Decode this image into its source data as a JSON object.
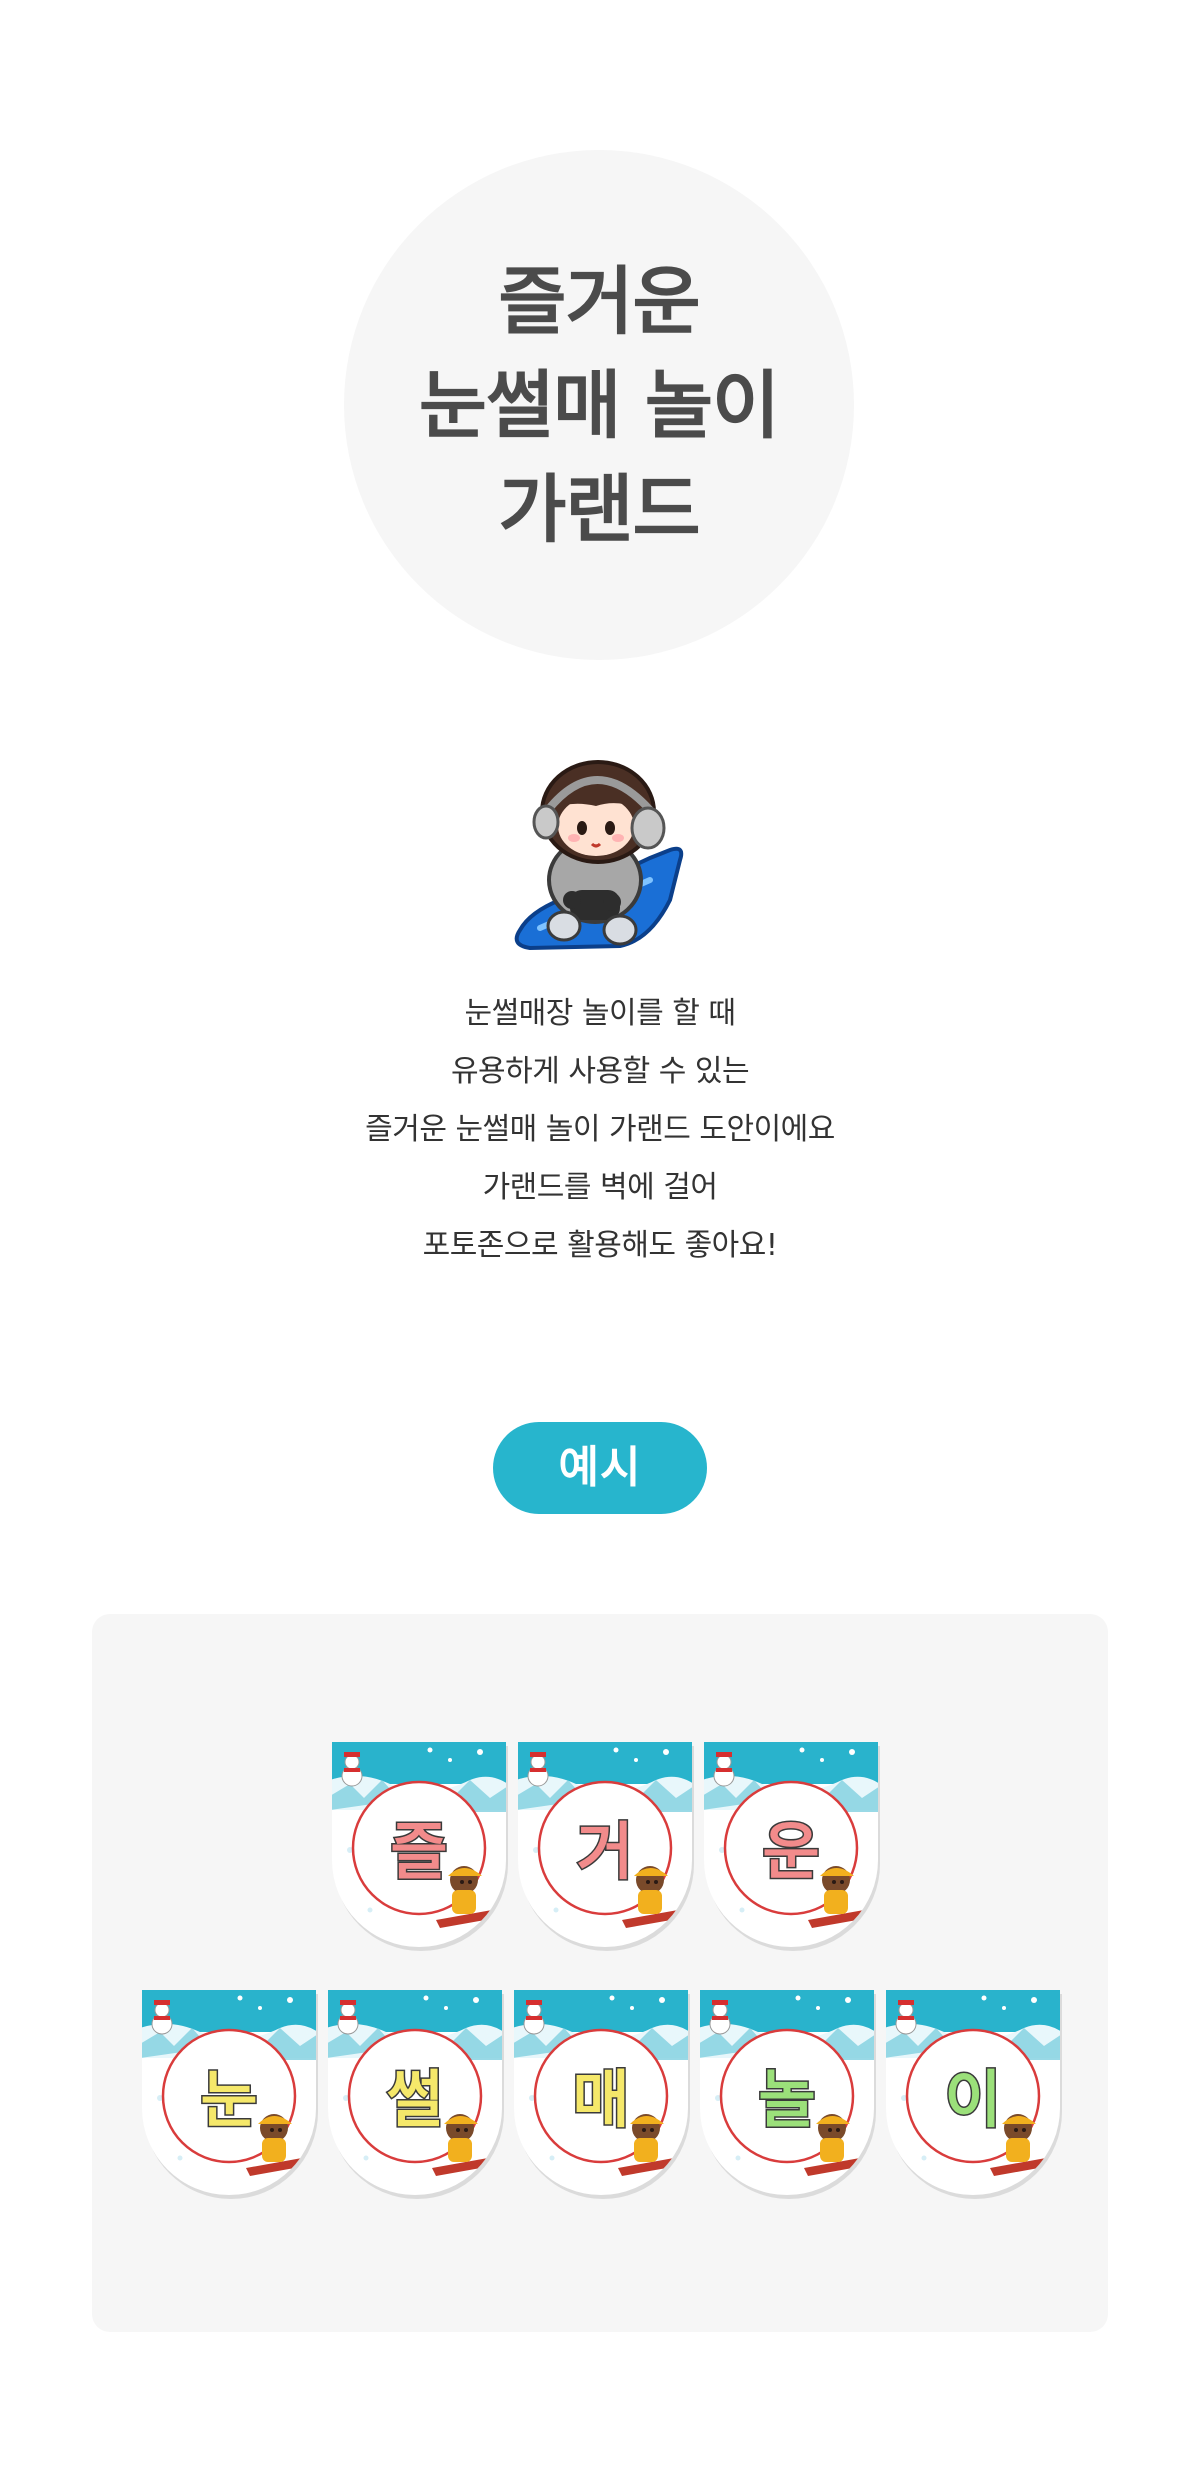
{
  "title": {
    "lines": [
      "즐거운",
      "눈썰매 놀이",
      "가랜드"
    ]
  },
  "mascot": {
    "icon": "child-on-sled-icon"
  },
  "description": {
    "lines": [
      "눈썰매장 놀이를 할 때",
      "유용하게 사용할 수 있는",
      "즐거운 눈썰매 놀이 가랜드 도안이에요",
      "가랜드를 벽에 걸어",
      "포토존으로 활용해도 좋아요!"
    ]
  },
  "example": {
    "label": "예시"
  },
  "garland": {
    "row1": [
      {
        "char": "즐",
        "color": "#f28b8b"
      },
      {
        "char": "거",
        "color": "#f28b8b"
      },
      {
        "char": "운",
        "color": "#f28b8b"
      }
    ],
    "row2": [
      {
        "char": "눈",
        "color": "#f5e86a"
      },
      {
        "char": "썰",
        "color": "#f5e86a"
      },
      {
        "char": "매",
        "color": "#f5e86a"
      },
      {
        "char": "놀",
        "color": "#9be07a"
      },
      {
        "char": "이",
        "color": "#9be07a"
      }
    ]
  },
  "colors": {
    "title": "#4b4b4b",
    "accent": "#27b5cd",
    "panel": "#f6f6f6",
    "circle": "#f6f6f6"
  }
}
